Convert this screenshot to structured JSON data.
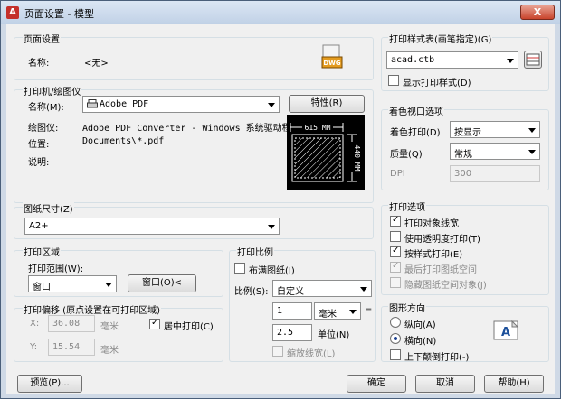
{
  "title": "页面设置 - 模型",
  "close": "X",
  "page_setup": {
    "heading": "页面设置",
    "name_label": "名称:",
    "name_value": "<无>",
    "dwg_icon_text": "DWG"
  },
  "printer": {
    "heading": "打印机/绘图仪",
    "name_label": "名称(M):",
    "name_value": "Adobe PDF",
    "properties_button": "特性(R)",
    "plotter_label": "绘图仪:",
    "plotter_value": "Adobe PDF Converter - Windows 系统驱动程...",
    "location_label": "位置:",
    "location_value": "Documents\\*.pdf",
    "description_label": "说明:",
    "preview_width": "615 MM",
    "preview_height": "440 MM"
  },
  "paper_size": {
    "heading": "图纸尺寸(Z)",
    "value": "A2+"
  },
  "plot_area": {
    "heading": "打印区域",
    "range_label": "打印范围(W):",
    "range_value": "窗口",
    "window_button": "窗口(O)<"
  },
  "plot_offset": {
    "heading": "打印偏移 (原点设置在可打印区域)",
    "x_label": "X:",
    "x_value": "36.08",
    "x_unit": "毫米",
    "y_label": "Y:",
    "y_value": "15.54",
    "y_unit": "毫米",
    "center_label": "居中打印(C)",
    "center_checked": true
  },
  "plot_scale": {
    "heading": "打印比例",
    "fit_label": "布满图纸(I)",
    "fit_checked": false,
    "scale_label": "比例(S):",
    "scale_value": "自定义",
    "val1": "1",
    "unit1": "毫米",
    "equals": "=",
    "val2": "2.5",
    "unit2": "单位(N)",
    "lineweight_label": "缩放线宽(L)"
  },
  "plot_style": {
    "heading": "打印样式表(画笔指定)(G)",
    "value": "acad.ctb",
    "display_label": "显示打印样式(D)",
    "display_checked": false
  },
  "shaded": {
    "heading": "着色视口选项",
    "shade_label": "着色打印(D)",
    "shade_value": "按显示",
    "quality_label": "质量(Q)",
    "quality_value": "常规",
    "dpi_label": "DPI",
    "dpi_value": "300"
  },
  "plot_options": {
    "heading": "打印选项",
    "items": [
      {
        "label": "打印对象线宽",
        "checked": true,
        "disabled": false
      },
      {
        "label": "使用透明度打印(T)",
        "checked": false,
        "disabled": false
      },
      {
        "label": "按样式打印(E)",
        "checked": true,
        "disabled": false
      },
      {
        "label": "最后打印图纸空间",
        "checked": true,
        "disabled": true
      },
      {
        "label": "隐藏图纸空间对象(J)",
        "checked": false,
        "disabled": true
      }
    ]
  },
  "orientation": {
    "heading": "图形方向",
    "portrait": "纵向(A)",
    "landscape": "横向(N)",
    "selected": "landscape",
    "upside_down": "上下颠倒打印(-)",
    "upside_down_checked": false,
    "icon_letter": "A"
  },
  "footer": {
    "preview": "预览(P)...",
    "ok": "确定",
    "cancel": "取消",
    "help": "帮助(H)"
  }
}
